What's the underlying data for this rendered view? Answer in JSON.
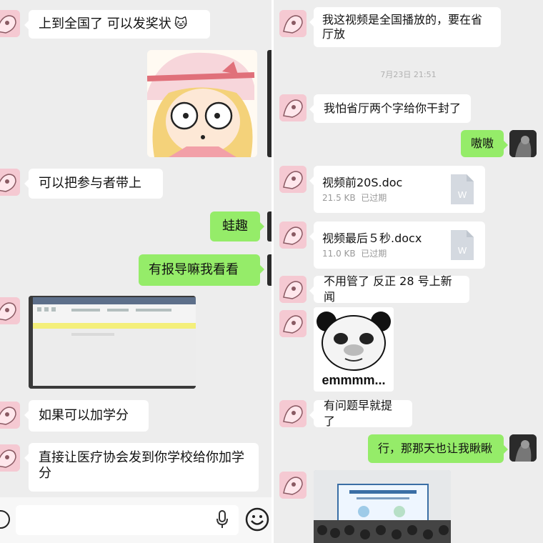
{
  "left": {
    "messages": [
      {
        "text": "上到全国了 可以发奖状"
      },
      {
        "text": "可以把参与者带上"
      },
      {
        "text": "蛙趣"
      },
      {
        "text": "有报导嘛我看看"
      },
      {
        "text": "如果可以加学分"
      },
      {
        "text": "直接让医疗协会发到你学校给你加学分"
      }
    ],
    "icons": {
      "cat_emoji": "cat-face-emoji-icon",
      "mic": "microphone-icon",
      "emoji": "smiley-icon"
    }
  },
  "right": {
    "messages": [
      {
        "text": "我这视频是全国播放的，要在省厅放"
      },
      {
        "text": "我怕省厅两个字给你干封了"
      },
      {
        "text": "嗷嗷"
      },
      {
        "text": "不用管了 反正 28 号上新闻"
      },
      {
        "text": "有问题早就提了"
      },
      {
        "text": "行，那那天也让我瞅瞅"
      }
    ],
    "timestamp": "7月23日 21:51",
    "files": [
      {
        "name": "视频前20S.doc",
        "size": "21.5 KB",
        "status": "已过期",
        "icon_letter": "W"
      },
      {
        "name": "视频最后５秒.docx",
        "size": "11.0 KB",
        "status": "已过期",
        "icon_letter": "W"
      }
    ],
    "sticker_caption": "emmmm..."
  },
  "colors": {
    "bg": "#ededed",
    "green_bubble": "#95ec69",
    "white_bubble": "#ffffff"
  }
}
